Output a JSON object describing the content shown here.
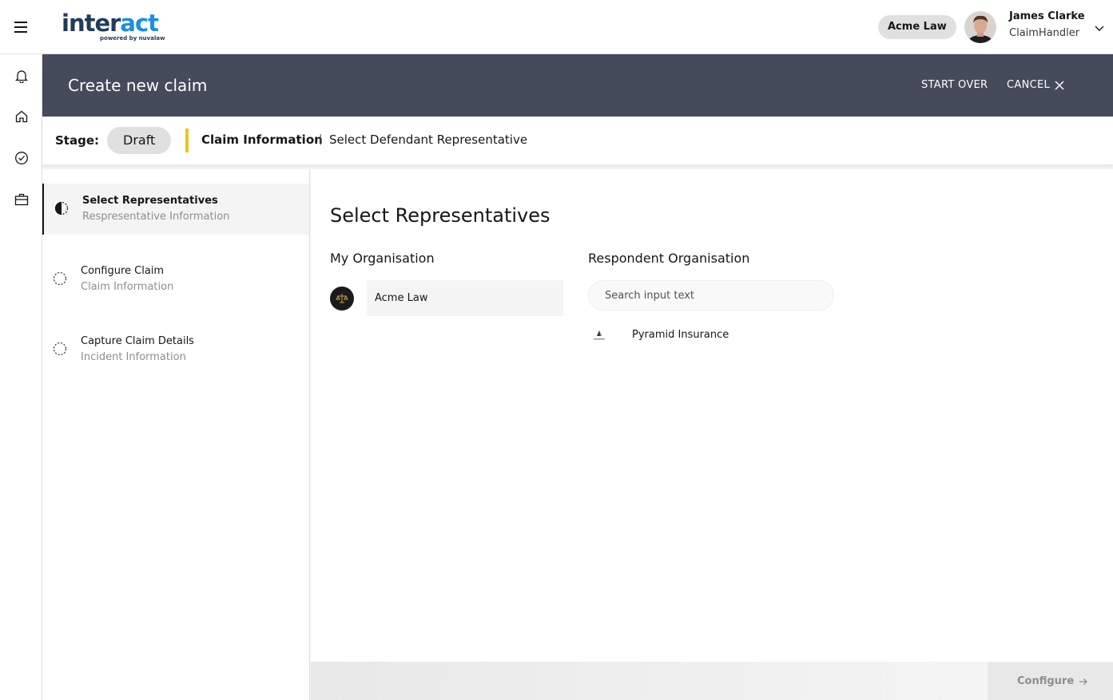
{
  "header": {
    "logo_part1": "inter",
    "logo_part2": "act",
    "logo_tagline": "powered by nuvalaw",
    "org_pill": "Acme Law",
    "user_name": "James Clarke",
    "user_role": "ClaimHandler"
  },
  "rail": {
    "items": [
      "bell-icon",
      "home-icon",
      "checkmark-circle-icon",
      "briefcase-icon"
    ]
  },
  "banner": {
    "title": "Create new claim",
    "start_over": "START OVER",
    "cancel": "CANCEL"
  },
  "stagebar": {
    "label": "Stage:",
    "stage": "Draft",
    "crumb_main": "Claim Information",
    "crumb_sep": "|",
    "crumb_sub": "Select Defendant Representative"
  },
  "steps": [
    {
      "title": "Select Representatives",
      "subtitle": "Respresentative Information",
      "state": "in-progress"
    },
    {
      "title": "Configure Claim",
      "subtitle": "Claim Information",
      "state": "not-started"
    },
    {
      "title": "Capture Claim Details",
      "subtitle": "Incident Information",
      "state": "not-started"
    }
  ],
  "main": {
    "title": "Select Representatives",
    "my_org_heading": "My Organisation",
    "my_org_value": "Acme Law",
    "respondent_heading": "Respondent Organisation",
    "search_placeholder": "Search input text",
    "respondent_result": "Pyramid Insurance"
  },
  "footer": {
    "configure_label": "Configure"
  },
  "colors": {
    "banner_bg": "#454b5b",
    "accent_yellow": "#f1c21b",
    "logo_dark": "#213b5c",
    "logo_blue": "#1b8fe0"
  }
}
